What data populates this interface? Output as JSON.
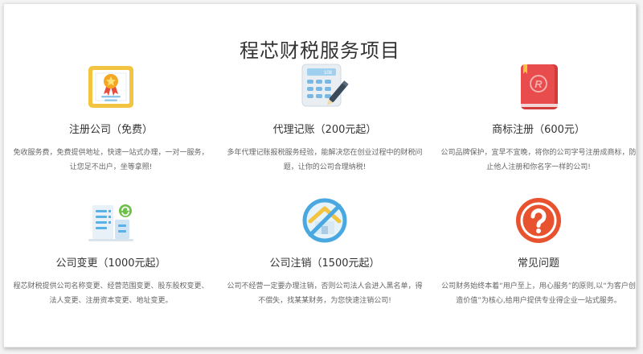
{
  "page": {
    "title": "程芯财税服务项目"
  },
  "services": [
    {
      "name": "注册公司（免费）",
      "desc": "免收服务费，免费提供地址，快速一站式办理，一对一服务，让您足不出户，坐等拿照!",
      "icon": "certificate-icon",
      "color": "#f3c43f"
    },
    {
      "name": "代理记账（200元起）",
      "desc": "多年代理记账报税服务经验，能解决您在创业过程中的财税问题，让你的公司合理纳税!",
      "icon": "calculator-pen-icon",
      "color": "#4aa3df"
    },
    {
      "name": "商标注册（600元）",
      "desc": "公司品牌保护，宜早不宜晚，将你的公司字号注册成商标，防止他人注册和你名字一样的公司!",
      "icon": "trademark-book-icon",
      "color": "#e84c4c"
    },
    {
      "name": "公司变更（1000元起）",
      "desc": "程芯财税提供公司名称变更、经营范围变更、股东股权变更、法人变更、注册资本变更、地址变更。",
      "icon": "building-refresh-icon",
      "color": "#5ab0e8"
    },
    {
      "name": "公司注销（1500元起）",
      "desc": "公司不经营一定要办理注销，否则公司法人会进入黑名单，得不偿失，找某某财务，为您快速注销公司!",
      "icon": "no-house-icon",
      "color": "#4aa8e0"
    },
    {
      "name": "常见问题",
      "desc": "公司财务始终本着“用户至上，用心服务”的原则,以“为客户创造价值”为核心,给用户提供专业得企业一站式服务。",
      "icon": "question-icon",
      "color": "#e9522e"
    }
  ]
}
